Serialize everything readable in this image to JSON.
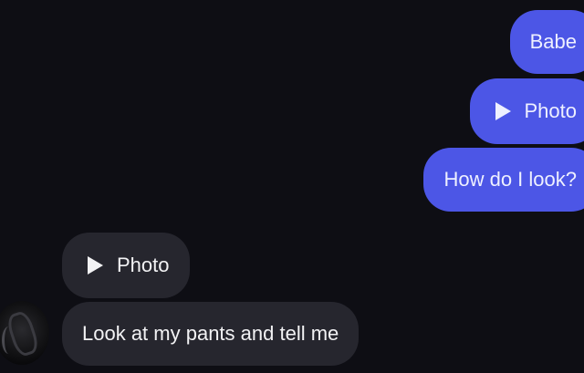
{
  "conversation": {
    "messages": [
      {
        "sender": "me",
        "kind": "text",
        "text": "Babe"
      },
      {
        "sender": "me",
        "kind": "photo",
        "text": "Photo",
        "icon": "play-icon"
      },
      {
        "sender": "me",
        "kind": "text",
        "text": "How do I look?"
      },
      {
        "sender": "other",
        "kind": "photo",
        "text": "Photo",
        "icon": "play-icon"
      },
      {
        "sender": "other",
        "kind": "text",
        "text": "Look at my pants and tell me"
      }
    ]
  },
  "colors": {
    "background": "#0e0e14",
    "sent_bubble": "#4c56e6",
    "received_bubble": "#26262e"
  }
}
